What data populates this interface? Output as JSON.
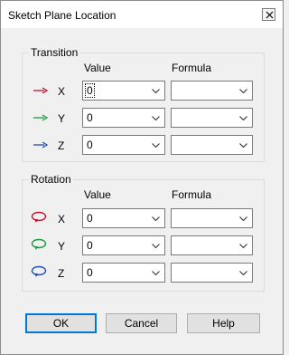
{
  "window": {
    "title": "Sketch Plane Location"
  },
  "transition": {
    "title": "Transition",
    "value_header": "Value",
    "formula_header": "Formula",
    "rows": [
      {
        "label": "X",
        "value": "0",
        "formula": "",
        "arrow_color": "#c8102e"
      },
      {
        "label": "Y",
        "value": "0",
        "formula": "",
        "arrow_color": "#1a9a3c"
      },
      {
        "label": "Z",
        "value": "0",
        "formula": "",
        "arrow_color": "#1f4fb0"
      }
    ]
  },
  "rotation": {
    "title": "Rotation",
    "value_header": "Value",
    "formula_header": "Formula",
    "rows": [
      {
        "label": "X",
        "value": "0",
        "formula": "",
        "icon_color": "#c8102e"
      },
      {
        "label": "Y",
        "value": "0",
        "formula": "",
        "icon_color": "#1a9a3c"
      },
      {
        "label": "Z",
        "value": "0",
        "formula": "",
        "icon_color": "#1f4fb0"
      }
    ]
  },
  "buttons": {
    "ok": "OK",
    "cancel": "Cancel",
    "help": "Help"
  }
}
